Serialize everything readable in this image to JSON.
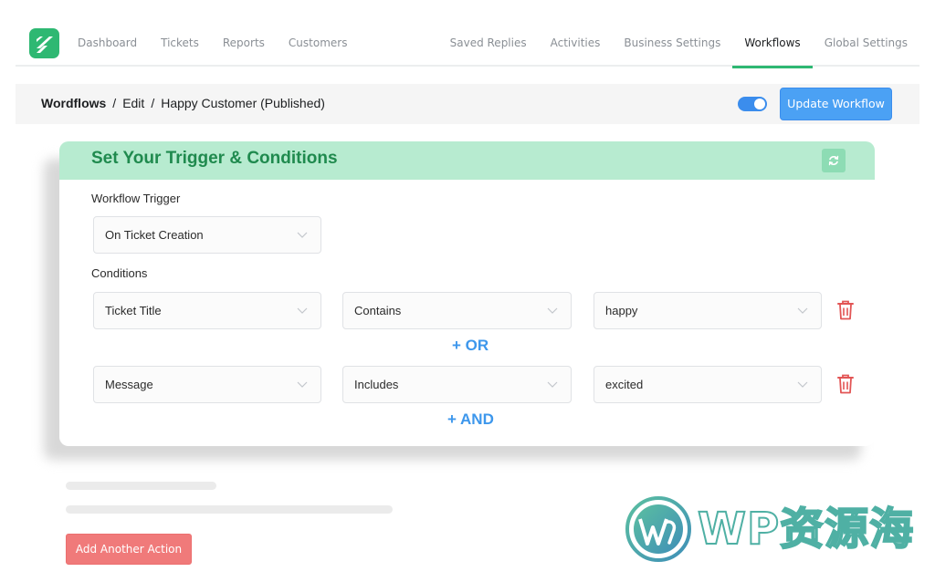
{
  "nav": {
    "left": [
      "Dashboard",
      "Tickets",
      "Reports",
      "Customers"
    ],
    "right": [
      "Saved Replies",
      "Activities",
      "Business Settings",
      "Workflows",
      "Global Settings"
    ],
    "active": "Workflows",
    "accent_color": "#2eb872"
  },
  "breadcrumb": {
    "root": "Wordflows",
    "separator": "/",
    "middle": "Edit",
    "current": "Happy Customer (Published)"
  },
  "toolbar": {
    "published_toggle_on": true,
    "update_label": "Update Workflow",
    "primary_color": "#4ba1f4"
  },
  "card": {
    "title": "Set Your Trigger & Conditions",
    "header_color": "#b7ebd0",
    "trigger_label": "Workflow Trigger",
    "trigger_value": "On Ticket Creation",
    "conditions_label": "Conditions",
    "rows": [
      {
        "field": "Ticket Title",
        "operator": "Contains",
        "value": "happy"
      },
      {
        "field": "Message",
        "operator": "Includes",
        "value": "excited"
      }
    ],
    "or_label": "+ OR",
    "and_label": "+ AND",
    "delete_icon": "trash-icon",
    "delete_color": "#e25555"
  },
  "actions": {
    "add_another_label": "Add Another Action",
    "danger_color": "#f07a7a"
  },
  "watermark": {
    "text": "WP资源海"
  }
}
